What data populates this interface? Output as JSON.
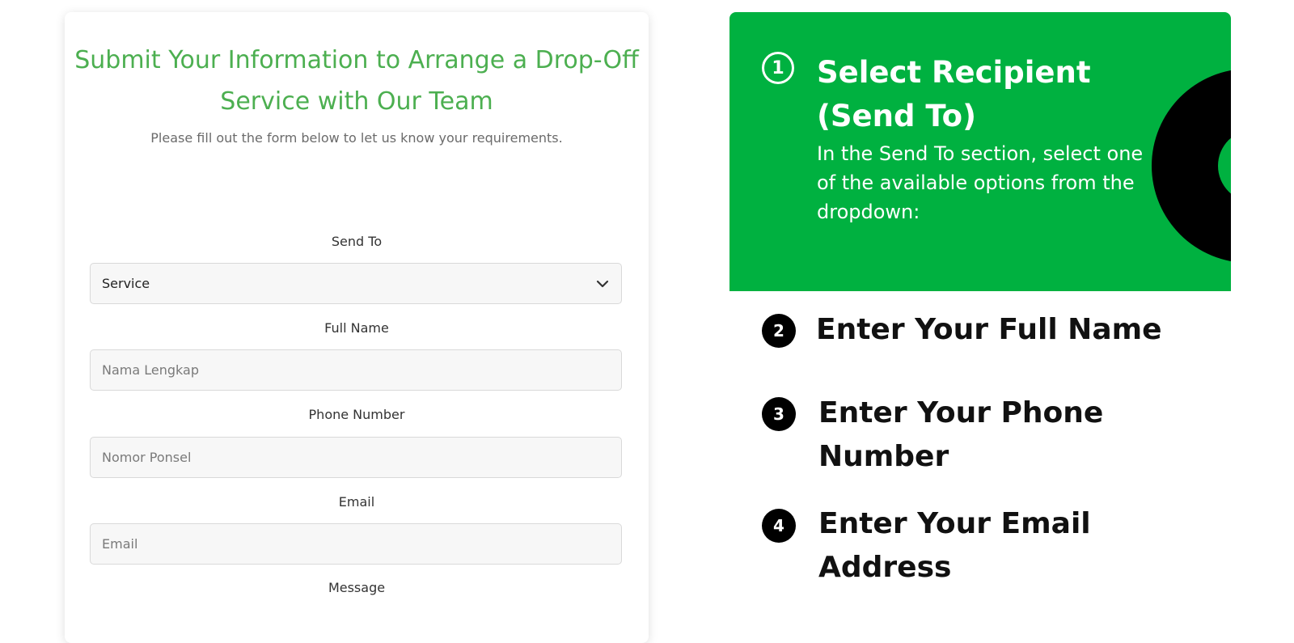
{
  "form": {
    "title": "Submit Your Information to Arrange a Drop-Off Service with Our Team",
    "subtitle": "Please fill out the form below to let us know your requirements.",
    "send_to": {
      "label": "Send To",
      "selected": "Service"
    },
    "full_name": {
      "label": "Full Name",
      "placeholder": "Nama Lengkap",
      "value": ""
    },
    "phone": {
      "label": "Phone Number",
      "placeholder": "Nomor Ponsel",
      "value": ""
    },
    "email": {
      "label": "Email",
      "placeholder": "Email",
      "value": ""
    },
    "message": {
      "label": "Message"
    }
  },
  "guide": {
    "accent_color": "#00b140",
    "steps": [
      {
        "number": "1",
        "title": "Select Recipient (Send To)",
        "description": "In the Send To section, select one of the available options from the dropdown:"
      },
      {
        "number": "2",
        "title": "Enter Your Full Name"
      },
      {
        "number": "3",
        "title": "Enter Your Phone Number"
      },
      {
        "number": "4",
        "title": "Enter Your Email Address"
      }
    ]
  }
}
